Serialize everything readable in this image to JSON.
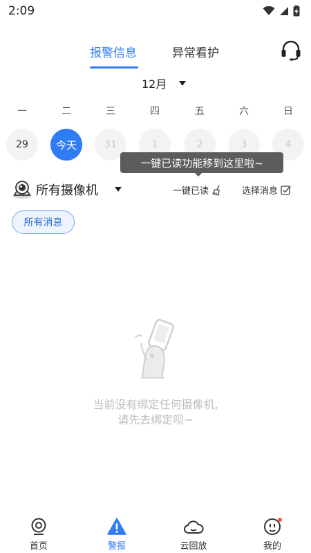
{
  "status_bar": {
    "time": "2:09"
  },
  "tabs": [
    {
      "label": "报警信息",
      "active": true
    },
    {
      "label": "异常看护",
      "active": false
    }
  ],
  "header": {
    "service_icon": "headset-icon"
  },
  "calendar": {
    "month": "12月",
    "weekdays": [
      "一",
      "二",
      "三",
      "四",
      "五",
      "六",
      "日"
    ],
    "dates": [
      "29",
      "今天",
      "31",
      "1",
      "2",
      "3",
      "4"
    ],
    "today_index": 1
  },
  "tooltip": {
    "text": "一键已读功能移到这里啦~"
  },
  "camera_filter": {
    "label": "所有摄像机"
  },
  "actions": {
    "read_all": "一键已读",
    "select_messages": "选择消息"
  },
  "message_filter": {
    "chip": "所有消息"
  },
  "empty_state": {
    "line1": "当前没有绑定任何摄像机,",
    "line2": "请先去绑定呗~"
  },
  "bottom_nav": [
    {
      "label": "首页",
      "icon": "home-camera-icon",
      "active": false
    },
    {
      "label": "警报",
      "icon": "alert-icon",
      "active": true
    },
    {
      "label": "云回放",
      "icon": "cloud-icon",
      "active": false
    },
    {
      "label": "我的",
      "icon": "profile-icon",
      "active": false,
      "badge": true
    }
  ],
  "colors": {
    "accent": "#2f7cf6",
    "tooltip_bg": "#5c5c5c",
    "badge": "#ff4d4f"
  }
}
